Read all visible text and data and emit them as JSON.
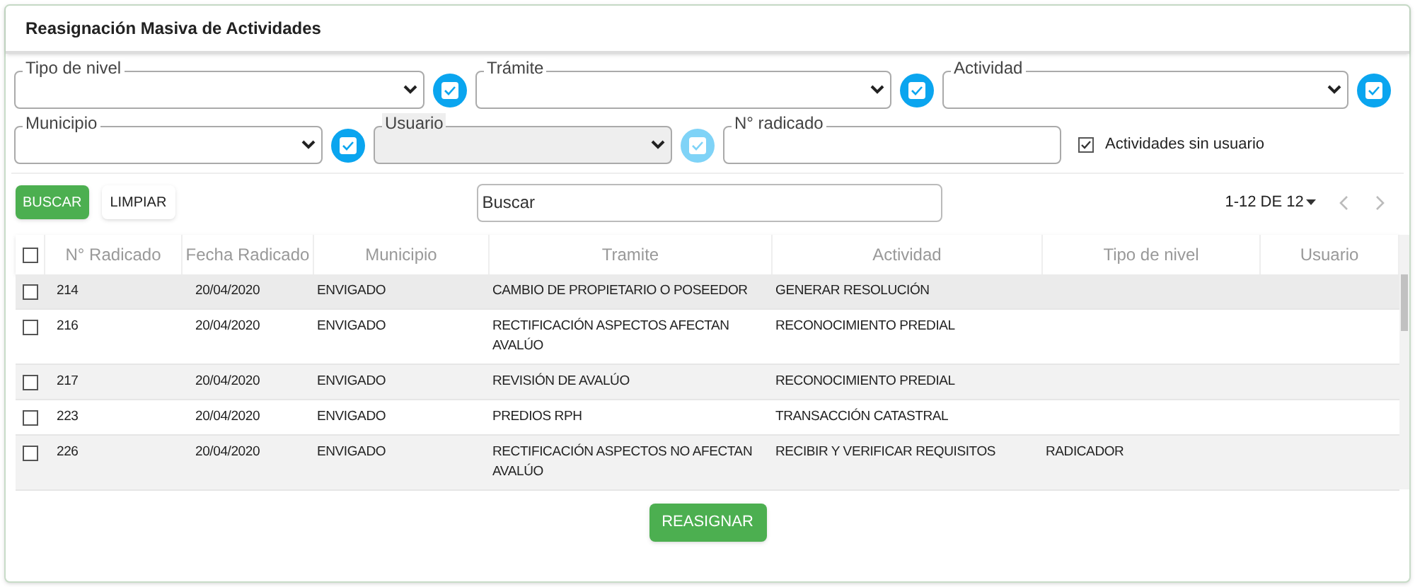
{
  "title": "Reasignación Masiva de Actividades",
  "filters": [
    {
      "label": "Tipo de nivel",
      "kind": "select",
      "disabled": false,
      "toggle_checked": true
    },
    {
      "label": "Trámite",
      "kind": "select",
      "disabled": false,
      "toggle_checked": true
    },
    {
      "label": "Actividad",
      "kind": "select",
      "disabled": false,
      "toggle_checked": true
    },
    {
      "label": "Municipio",
      "kind": "select",
      "disabled": false,
      "toggle_checked": true
    },
    {
      "label": "Usuario",
      "kind": "select",
      "disabled": true,
      "toggle_checked": true
    },
    {
      "label": "N° radicado",
      "kind": "input",
      "disabled": false
    }
  ],
  "unassigned_option": {
    "label": "Actividades sin usuario",
    "checked": true
  },
  "buttons": {
    "search": "BUSCAR",
    "clear": "LIMPIAR",
    "reassign": "REASIGNAR"
  },
  "search": {
    "placeholder": "Buscar"
  },
  "pagination": {
    "range": "1-12 DE 12"
  },
  "table": {
    "select_all_checked": false,
    "columns": [
      "N° Radicado",
      "Fecha Radicado",
      "Municipio",
      "Tramite",
      "Actividad",
      "Tipo de nivel",
      "Usuario"
    ],
    "rows": [
      {
        "checked": false,
        "cells": [
          "214",
          "20/04/2020",
          "ENVIGADO",
          "CAMBIO DE PROPIETARIO O POSEEDOR",
          "GENERAR RESOLUCIÓN",
          "",
          ""
        ]
      },
      {
        "checked": false,
        "cells": [
          "216",
          "20/04/2020",
          "ENVIGADO",
          "RECTIFICACIÓN ASPECTOS AFECTAN AVALÚO",
          "RECONOCIMIENTO PREDIAL",
          "",
          ""
        ]
      },
      {
        "checked": false,
        "cells": [
          "217",
          "20/04/2020",
          "ENVIGADO",
          "REVISIÓN DE AVALÚO",
          "RECONOCIMIENTO PREDIAL",
          "",
          ""
        ]
      },
      {
        "checked": false,
        "cells": [
          "223",
          "20/04/2020",
          "ENVIGADO",
          "PREDIOS RPH",
          "TRANSACCIÓN CATASTRAL",
          "",
          ""
        ]
      },
      {
        "checked": false,
        "cells": [
          "226",
          "20/04/2020",
          "ENVIGADO",
          "RECTIFICACIÓN ASPECTOS NO AFECTAN AVALÚO",
          "RECIBIR Y VERIFICAR REQUISITOS",
          "RADICADOR",
          ""
        ]
      }
    ]
  }
}
